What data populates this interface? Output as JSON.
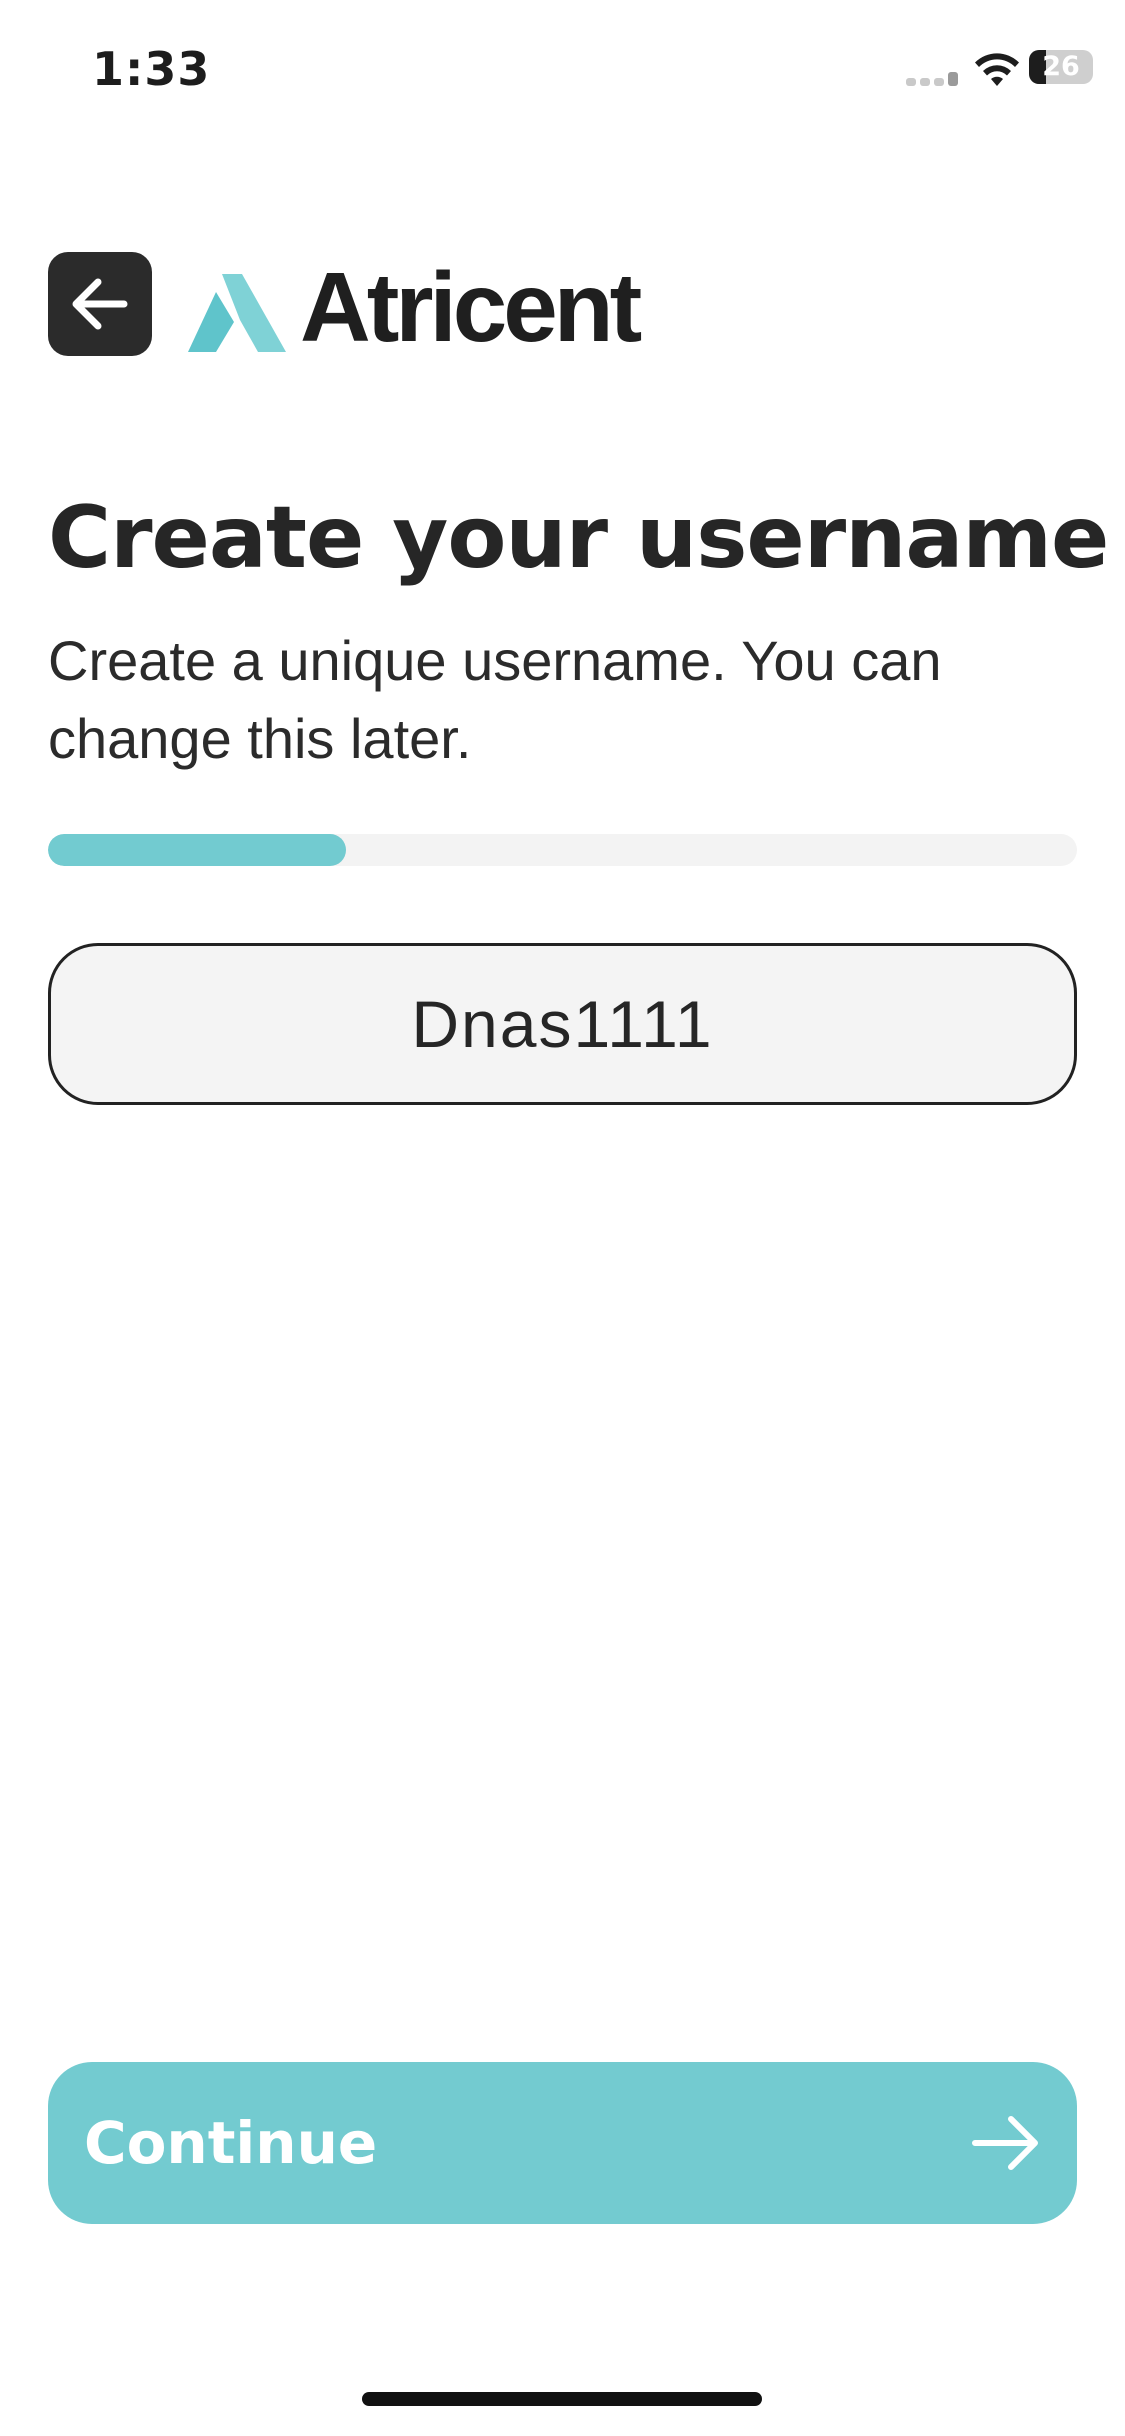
{
  "status_bar": {
    "time": "1:33",
    "battery_level": "26",
    "signal_icon": "cellular-signal-icon",
    "wifi_icon": "wifi-icon",
    "battery_icon": "battery-icon"
  },
  "header": {
    "back_icon": "arrow-left-icon",
    "brand_name": "Atricent",
    "brand_mark_color": "#72CBD0"
  },
  "main": {
    "title": "Create your username",
    "subtitle": "Create a unique username. You can change this later.",
    "progress_percent": 29,
    "username_value": "Dnas1111"
  },
  "footer": {
    "continue_label": "Continue",
    "continue_icon": "arrow-right-icon",
    "accent_color": "#73CBD0"
  }
}
